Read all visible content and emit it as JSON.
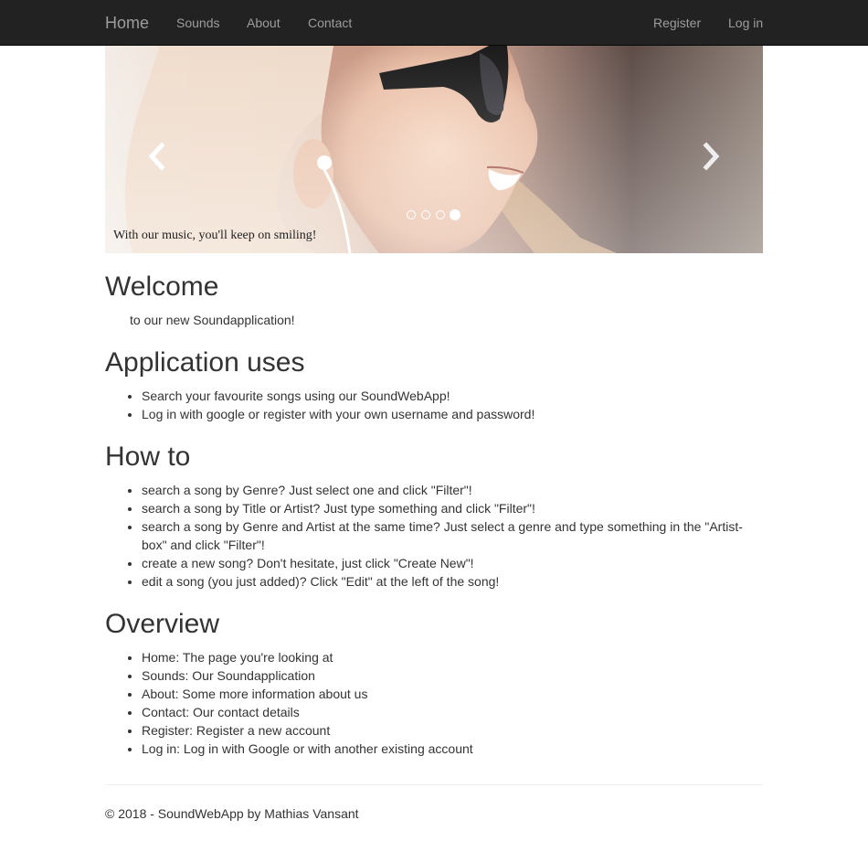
{
  "nav": {
    "brand": "Home",
    "links": [
      "Sounds",
      "About",
      "Contact"
    ],
    "right_links": [
      "Register",
      "Log in"
    ]
  },
  "carousel": {
    "caption": "With our music, you'll keep on smiling!",
    "prev_icon": "chevron-left-icon",
    "next_icon": "chevron-right-icon",
    "slide_count": 4,
    "active_slide": 4
  },
  "welcome": {
    "heading": "Welcome",
    "text": "to our new Soundapplication!"
  },
  "uses": {
    "heading": "Application uses",
    "items": [
      "Search your favourite songs using our SoundWebApp!",
      "Log in with google or register with your own username and password!"
    ]
  },
  "howto": {
    "heading": "How to",
    "items": [
      "search a song by Genre? Just select one and click \"Filter\"!",
      "search a song by Title or Artist? Just type something and click \"Filter\"!",
      "search a song by Genre and Artist at the same time? Just select a genre and type something in the \"Artist-box\" and click \"Filter\"!",
      "create a new song? Don't hesitate, just click \"Create New\"!",
      "edit a song (you just added)? Click \"Edit\" at the left of the song!"
    ]
  },
  "overview": {
    "heading": "Overview",
    "items": [
      "Home: The page you're looking at",
      "Sounds: Our Soundapplication",
      "About: Some more information about us",
      "Contact: Our contact details",
      "Register: Register a new account",
      "Log in: Log in with Google or with another existing account"
    ]
  },
  "footer": {
    "text": "© 2018 - SoundWebApp by Mathias Vansant"
  },
  "colors": {
    "navbar_bg": "#222222",
    "nav_text": "#9d9d9d",
    "body_text": "#333333"
  }
}
